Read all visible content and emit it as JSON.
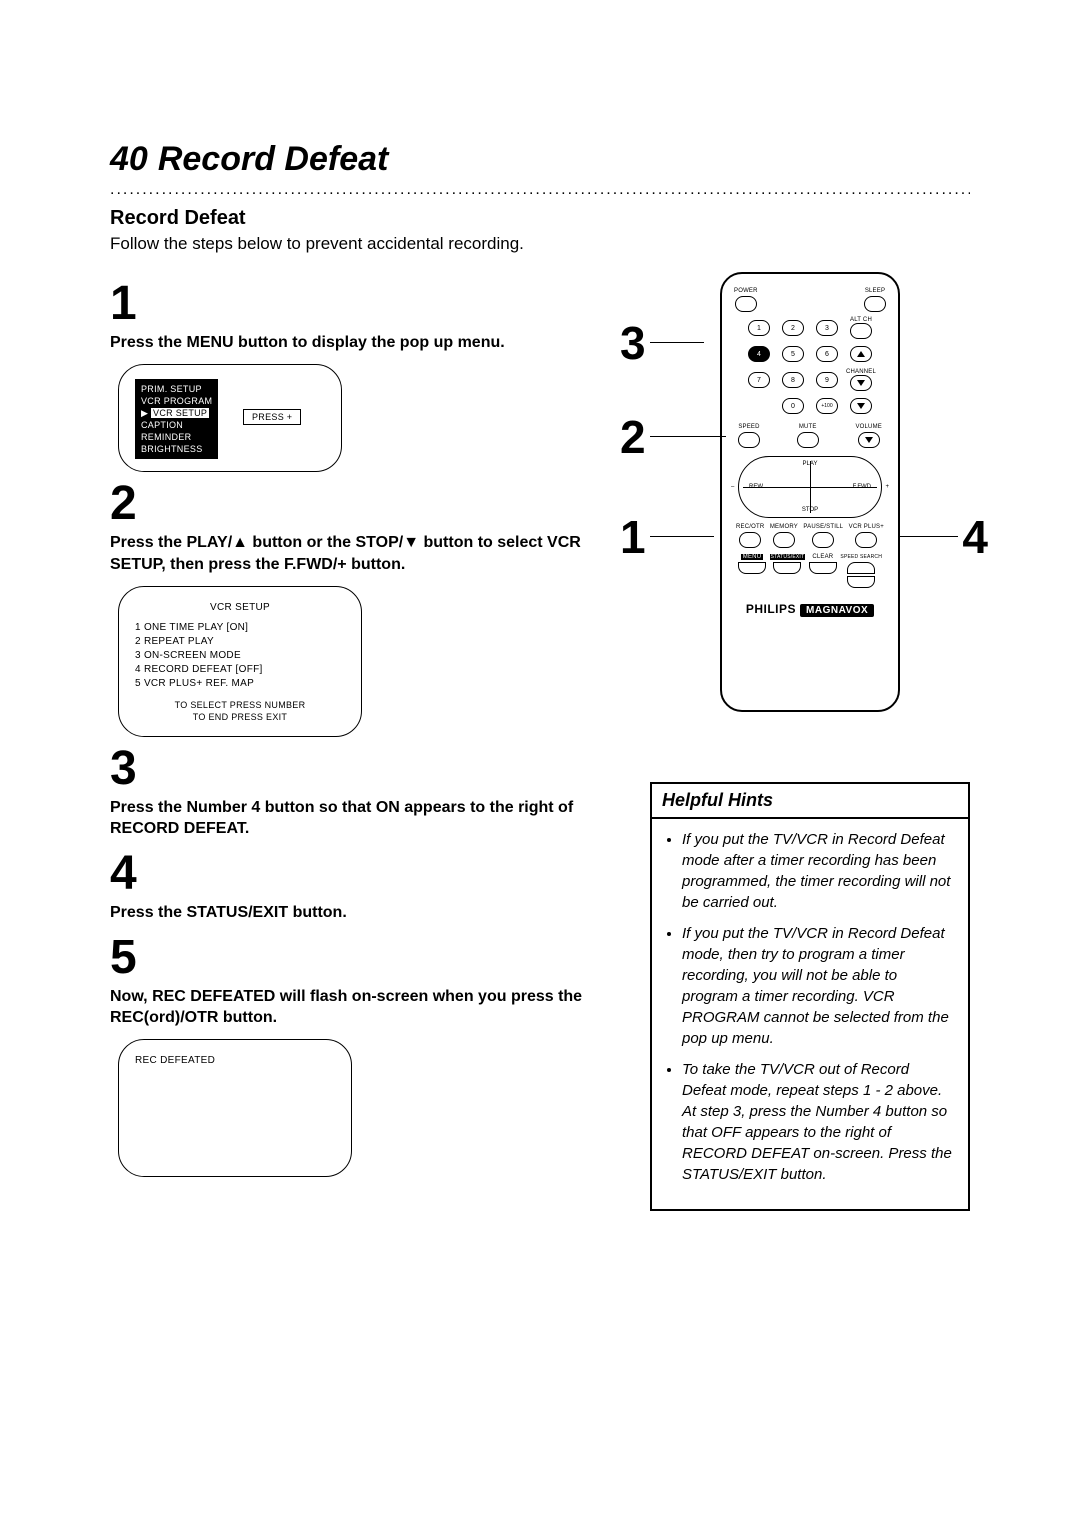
{
  "page_number": "40",
  "page_title": "Record Defeat",
  "section_heading": "Record Defeat",
  "intro": "Follow the steps below to prevent accidental recording.",
  "steps": {
    "s1": {
      "num": "1",
      "text": "Press the MENU button to display the pop up menu."
    },
    "s2": {
      "num": "2",
      "text": "Press the PLAY/▲ button or the STOP/▼ button to select VCR SETUP, then press the F.FWD/+ button."
    },
    "s3": {
      "num": "3",
      "text": "Press the Number 4 button so that ON appears to the right of RECORD DEFEAT."
    },
    "s4": {
      "num": "4",
      "text": "Press the STATUS/EXIT button."
    },
    "s5": {
      "num": "5",
      "text": "Now, REC DEFEATED will flash on-screen when you press the REC(ord)/OTR button."
    }
  },
  "osd1": {
    "items": [
      "PRIM. SETUP",
      "VCR PROGRAM",
      "VCR SETUP",
      "CAPTION",
      "REMINDER",
      "BRIGHTNESS"
    ],
    "selected_index": 2,
    "press_tag": "PRESS +"
  },
  "osd2": {
    "title": "VCR SETUP",
    "rows": [
      "1  ONE TIME PLAY       [ON]",
      "2  REPEAT PLAY",
      "3  ON-SCREEN MODE",
      "4  RECORD DEFEAT    [OFF]",
      "5  VCR PLUS+ REF. MAP"
    ],
    "foot1": "TO SELECT PRESS NUMBER",
    "foot2": "TO END PRESS EXIT"
  },
  "osd3": {
    "text": "REC DEFEATED"
  },
  "remote": {
    "power": "POWER",
    "sleep": "SLEEP",
    "altch": "ALT CH",
    "channel": "CHANNEL",
    "speed": "SPEED",
    "mute": "MUTE",
    "volume": "VOLUME",
    "play": "PLAY",
    "rew": "REW",
    "ffwd": "F.FWD",
    "stop": "STOP",
    "minus": "–",
    "plus": "+",
    "row5": [
      "REC/OTR",
      "MEMORY",
      "PAUSE/STILL",
      "VCR PLUS+"
    ],
    "row4": [
      "MENU",
      "STATUS/EXIT",
      "CLEAR",
      "SPEED SEARCH"
    ],
    "brand1": "PHILIPS",
    "brand2": "MAGNAVOX",
    "num": [
      "1",
      "2",
      "3",
      "4",
      "5",
      "6",
      "7",
      "8",
      "9",
      "0",
      "+100"
    ]
  },
  "callouts": {
    "c1": "1",
    "c2": "2",
    "c3": "3",
    "c4": "4"
  },
  "hints": {
    "title": "Helpful Hints",
    "items": [
      "If you put the TV/VCR in Record Defeat mode after a timer recording has been programmed, the timer recording will not be carried out.",
      "If you put the TV/VCR in Record Defeat mode, then try to program a timer recording, you will not be able to program a timer recording.  VCR PROGRAM cannot be selected from the pop up menu.",
      "To take the TV/VCR out of Record Defeat mode, repeat steps 1 - 2 above.  At step 3, press the Number 4 button so that OFF appears to the right of RECORD DEFEAT on-screen. Press the STATUS/EXIT button."
    ]
  }
}
